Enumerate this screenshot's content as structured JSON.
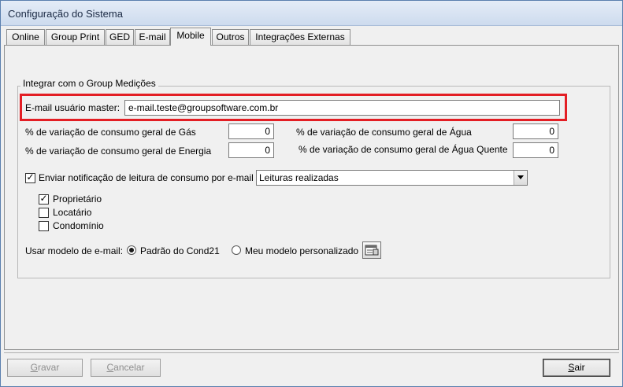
{
  "window": {
    "title": "Configuração do Sistema"
  },
  "tabs": [
    {
      "label": "Online"
    },
    {
      "label": "Group Print"
    },
    {
      "label": "GED"
    },
    {
      "label": "E-mail"
    },
    {
      "label": "Mobile",
      "active": true
    },
    {
      "label": "Outros"
    },
    {
      "label": "Integrações Externas"
    }
  ],
  "group": {
    "legend": "Integrar com o Group Medições",
    "master_email": {
      "label": "E-mail usuário master:",
      "value": "e-mail.teste@groupsoftware.com.br"
    },
    "variations": [
      {
        "label": "% de variação de consumo geral de Gás",
        "value": "0"
      },
      {
        "label": "% de variação de consumo geral de Energia",
        "value": "0"
      },
      {
        "label": "% de variação de consumo geral de Água",
        "value": "0"
      },
      {
        "label": "% de variação de consumo geral de Água Quente",
        "value": "0"
      }
    ],
    "notify": {
      "label": "Enviar notificação de leitura de consumo por e-mail",
      "checked": true,
      "selected": "Leituras realizadas"
    },
    "recipients": [
      {
        "label": "Proprietário",
        "checked": true
      },
      {
        "label": "Locatário",
        "checked": false
      },
      {
        "label": "Condomínio",
        "checked": false
      }
    ],
    "template": {
      "label": "Usar modelo de e-mail:",
      "options": [
        {
          "label": "Padrão do Cond21",
          "selected": true
        },
        {
          "label": "Meu modelo personalizado",
          "selected": false
        }
      ],
      "edit_icon": "template-editor-icon"
    }
  },
  "buttons": {
    "save": {
      "prefix": "",
      "accel": "G",
      "rest": "ravar",
      "enabled": false
    },
    "cancel": {
      "prefix": "",
      "accel": "C",
      "rest": "ancelar",
      "enabled": false
    },
    "exit": {
      "prefix": "",
      "accel": "S",
      "rest": "air",
      "enabled": true
    }
  },
  "colors": {
    "highlight": "#e31e24",
    "titlebar": "#cddbee",
    "background": "#f0f0f0"
  }
}
